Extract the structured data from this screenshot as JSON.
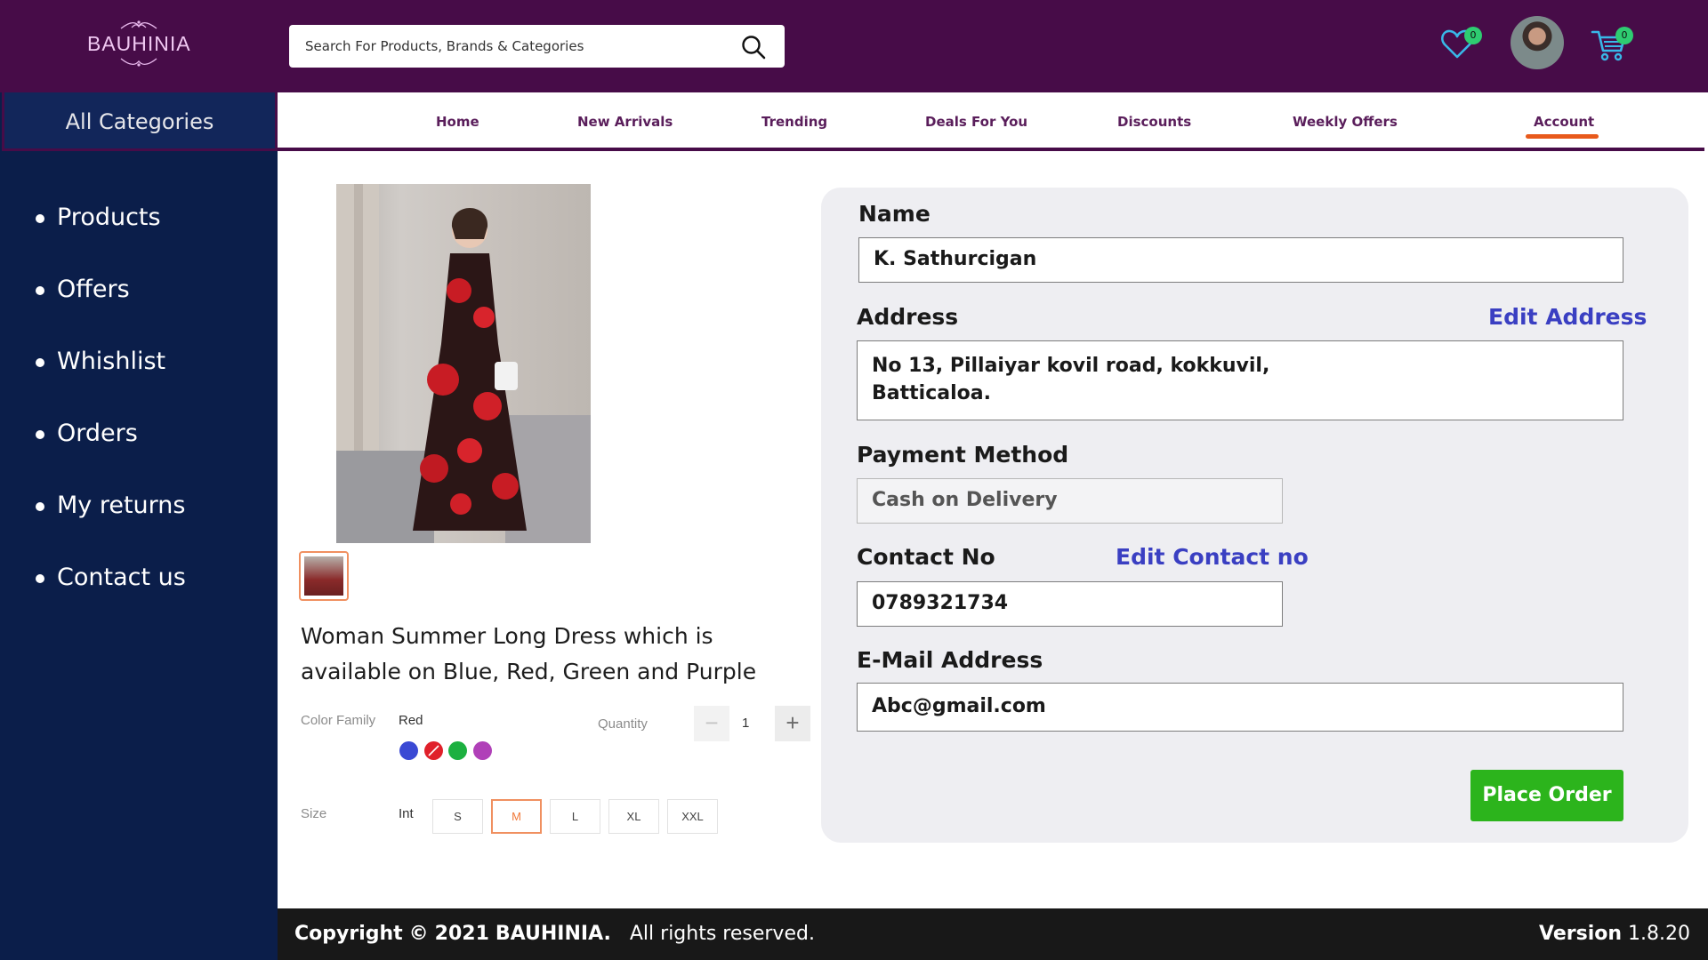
{
  "brand": {
    "logo_text": "BAUHINIA"
  },
  "search": {
    "placeholder": "Search For Products, Brands & Categories"
  },
  "header_icons": {
    "wishlist": {
      "icon": "heart-icon",
      "count": "0"
    },
    "avatar": {
      "icon": "user-avatar"
    },
    "cart": {
      "icon": "cart-icon",
      "count": "0"
    }
  },
  "sidebar": {
    "title": "All Categories",
    "items": [
      {
        "label": "Products"
      },
      {
        "label": "Offers"
      },
      {
        "label": "Whishlist"
      },
      {
        "label": "Orders"
      },
      {
        "label": "My returns"
      },
      {
        "label": "Contact us"
      }
    ]
  },
  "nav": {
    "items": [
      {
        "label": "Home"
      },
      {
        "label": "New Arrivals"
      },
      {
        "label": "Trending"
      },
      {
        "label": "Deals For You"
      },
      {
        "label": "Discounts"
      },
      {
        "label": "Weekly Offers"
      },
      {
        "label": "Account"
      }
    ],
    "active": "Account"
  },
  "product": {
    "title": "Woman Summer Long Dress which is available on Blue, Red, Green and Purple",
    "color_family_label": "Color Family",
    "color_selected": "Red",
    "colors": [
      "#3a49d4",
      "#e0202a",
      "#1cb040",
      "#b040b8"
    ],
    "quantity_label": "Quantity",
    "quantity": "1",
    "qty_minus": "−",
    "qty_plus": "+",
    "size_label": "Size",
    "size_system": "Int",
    "sizes": [
      "S",
      "M",
      "L",
      "XL",
      "XXL"
    ],
    "size_selected": "M"
  },
  "form": {
    "name_label": "Name",
    "name_value": "K. Sathurcigan",
    "address_label": "Address",
    "edit_address": "Edit Address",
    "address_line1": "No 13, Pillaiyar kovil road, kokkuvil,",
    "address_line2": "Batticaloa.",
    "payment_label": "Payment Method",
    "payment_value": "Cash on Delivery",
    "contact_label": "Contact No",
    "edit_contact": "Edit Contact no",
    "contact_value": "0789321734",
    "email_label": "E-Mail Address",
    "email_value": "Abc@gmail.com",
    "place_order": "Place Order"
  },
  "footer": {
    "copyright": "Copyright",
    "symbol": "©",
    "year": "2021",
    "brand": "BAUHINIA.",
    "rights": "All rights reserved.",
    "version_label": "Version",
    "version": "1.8.20"
  },
  "colors": {
    "header_bg": "#470c48",
    "sidebar_bg": "#0b1e4a",
    "accent_link": "#3a3fc2",
    "order_button": "#2cb41c",
    "active_underline": "#e85a1c"
  }
}
